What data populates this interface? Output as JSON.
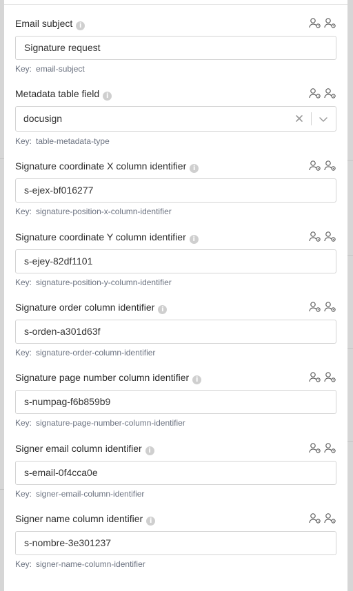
{
  "fields": [
    {
      "label": "Email subject",
      "value": "Signature request",
      "key_prefix": "Key:",
      "key": "email-subject",
      "type": "text"
    },
    {
      "label": "Metadata table field",
      "value": "docusign",
      "key_prefix": "Key:",
      "key": "table-metadata-type",
      "type": "select"
    },
    {
      "label": "Signature coordinate X column identifier",
      "value": "s-ejex-bf016277",
      "key_prefix": "Key:",
      "key": "signature-position-x-column-identifier",
      "type": "text"
    },
    {
      "label": "Signature coordinate Y column identifier",
      "value": "s-ejey-82df1101",
      "key_prefix": "Key:",
      "key": "signature-position-y-column-identifier",
      "type": "text"
    },
    {
      "label": "Signature order column identifier",
      "value": "s-orden-a301d63f",
      "key_prefix": "Key:",
      "key": "signature-order-column-identifier",
      "type": "text"
    },
    {
      "label": "Signature page number column identifier",
      "value": "s-numpag-f6b859b9",
      "key_prefix": "Key:",
      "key": "signature-page-number-column-identifier",
      "type": "text"
    },
    {
      "label": "Signer email column identifier",
      "value": "s-email-0f4cca0e",
      "key_prefix": "Key:",
      "key": "signer-email-column-identifier",
      "type": "text"
    },
    {
      "label": "Signer name column identifier",
      "value": "s-nombre-3e301237",
      "key_prefix": "Key:",
      "key": "signer-name-column-identifier",
      "type": "text"
    }
  ],
  "icons": {
    "info": "info-icon",
    "user_settings": "user-settings-icon",
    "clear": "clear-icon",
    "chevron": "chevron-down-icon"
  },
  "colors": {
    "label": "#2b2b2b",
    "key": "#6b7280",
    "border": "#d3d3d3",
    "icon": "#5f5f5f"
  }
}
